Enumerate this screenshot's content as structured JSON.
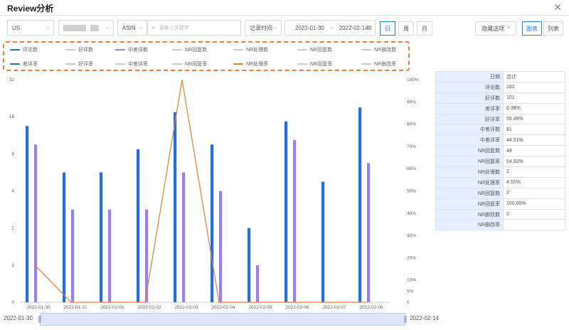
{
  "header": {
    "title": "Review分析"
  },
  "toolbar": {
    "marketplace": "US",
    "asin_type": "ASIN",
    "search_placeholder": "请输入关键字",
    "time_type": "记录时间",
    "date_start": "2022-01-30",
    "date_sep": "~",
    "date_end": "2022-02-14",
    "granularity": [
      "日",
      "周",
      "月"
    ],
    "hide_options": "隐藏选项",
    "view_chart": "图表",
    "view_list": "列表"
  },
  "legend": [
    {
      "name": "评论数",
      "color": "#1f6fe0"
    },
    {
      "name": "好评数",
      "color": "#c8c8c8"
    },
    {
      "name": "中差评数",
      "color": "#9b7fee"
    },
    {
      "name": "NR回复数",
      "color": "#c8c8c8"
    },
    {
      "name": "NR处理数",
      "color": "#c8c8c8"
    },
    {
      "name": "NR回复数",
      "color": "#c8c8c8"
    },
    {
      "name": "NR删改数",
      "color": "#c8c8c8"
    },
    {
      "name": "差评率",
      "color": "#1f6fe0"
    },
    {
      "name": "好评率",
      "color": "#c8c8c8"
    },
    {
      "name": "中差评率",
      "color": "#c8c8c8"
    },
    {
      "name": "NR回复率",
      "color": "#c8c8c8"
    },
    {
      "name": "NR处理率",
      "color": "#f07a2a"
    },
    {
      "name": "NR回复率",
      "color": "#c8c8c8"
    },
    {
      "name": "NR删改率",
      "color": "#c8c8c8"
    }
  ],
  "chart_data": {
    "type": "bar",
    "categories": [
      "2022-01-30",
      "2022-01-31",
      "2022-02-01",
      "2022-02-02",
      "2022-02-03",
      "2022-02-04",
      "2022-02-05",
      "2022-02-06",
      "2022-02-07",
      "2022-02-08"
    ],
    "y_left_ticks": [
      "0",
      "1",
      "2",
      "4",
      "8",
      "16",
      "32"
    ],
    "y_right_ticks": [
      "0",
      "5%",
      "10%",
      "20%",
      "30%",
      "40%",
      "50%",
      "60%",
      "70%",
      "80%",
      "90%",
      "100%"
    ],
    "series": [
      {
        "name": "评论数",
        "kind": "bar",
        "axis": "left",
        "color": "#1f6fe0",
        "values": [
          14,
          6,
          6,
          9,
          18,
          10,
          2,
          15,
          5,
          20
        ]
      },
      {
        "name": "中差评数",
        "kind": "bar",
        "axis": "left",
        "color": "#9b7fee",
        "values": [
          10,
          3,
          3,
          3,
          6,
          4,
          1,
          11,
          null,
          7
        ]
      },
      {
        "name": "NR处理率",
        "kind": "line",
        "axis": "right",
        "color": "#f07a2a",
        "values": [
          17,
          0,
          0,
          0,
          100,
          0,
          0,
          0,
          0,
          0
        ]
      }
    ],
    "range_start": "2022-01-30",
    "range_end": "2022-02-14"
  },
  "stats": [
    {
      "k": "日期",
      "v": "合计"
    },
    {
      "k": "评论数",
      "v": "182"
    },
    {
      "k": "好评数",
      "v": "101"
    },
    {
      "k": "差评率",
      "v": "0.38%"
    },
    {
      "k": "好评率",
      "v": "55.49%"
    },
    {
      "k": "中差评数",
      "v": "81"
    },
    {
      "k": "中差评率",
      "v": "44.51%"
    },
    {
      "k": "NR回复数",
      "v": "44"
    },
    {
      "k": "NR回复率",
      "v": "54.32%"
    },
    {
      "k": "NR处理数",
      "v": "2"
    },
    {
      "k": "NR处理率",
      "v": "4.55%"
    },
    {
      "k": "NR回复数",
      "v": "2"
    },
    {
      "k": "NR回复率",
      "v": "100.00%"
    },
    {
      "k": "NR删改数",
      "v": "0"
    },
    {
      "k": "NR删改率",
      "v": ""
    }
  ]
}
